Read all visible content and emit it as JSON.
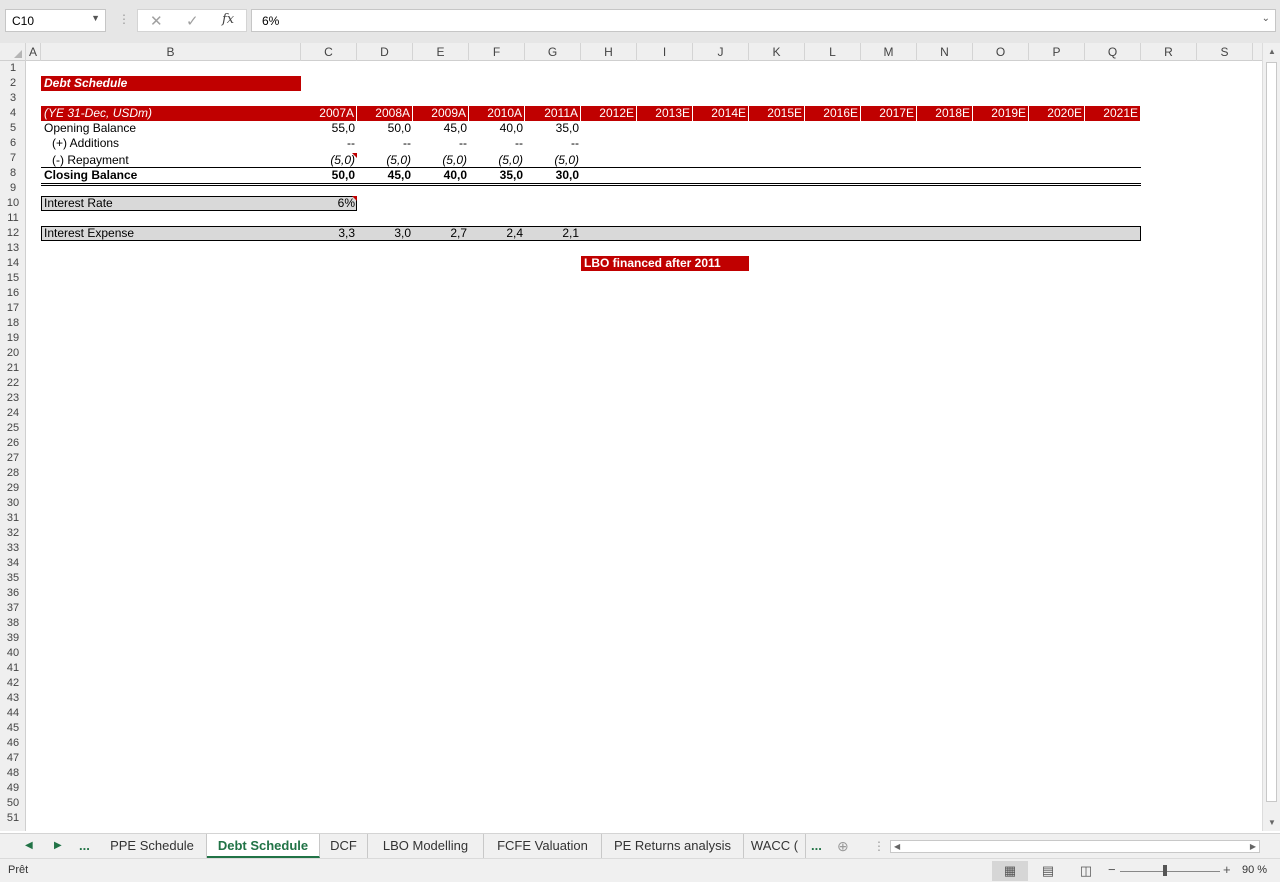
{
  "formula_bar": {
    "name_box": "C10",
    "formula": "6%",
    "cancel_icon": "✕",
    "enter_icon": "✓",
    "fx_icon": "fx"
  },
  "columns": [
    "A",
    "B",
    "C",
    "D",
    "E",
    "F",
    "G",
    "H",
    "I",
    "J",
    "K",
    "L",
    "M",
    "N",
    "O",
    "P",
    "Q",
    "R",
    "S"
  ],
  "rows": [
    "1",
    "2",
    "3",
    "4",
    "5",
    "6",
    "7",
    "8",
    "9",
    "10",
    "11",
    "12",
    "13",
    "14",
    "15",
    "16",
    "17",
    "18",
    "19",
    "20",
    "21",
    "22",
    "23",
    "24",
    "25",
    "26",
    "27",
    "28",
    "29",
    "30",
    "31",
    "32",
    "33",
    "34",
    "35",
    "36",
    "37",
    "38",
    "39",
    "40",
    "41",
    "42",
    "43",
    "44",
    "45",
    "46",
    "47",
    "48",
    "49",
    "50",
    "51"
  ],
  "sheet": {
    "title": "Debt Schedule",
    "header_label": "(YE 31-Dec, USDm)",
    "years": [
      "2007A",
      "2008A",
      "2009A",
      "2010A",
      "2011A",
      "2012E",
      "2013E",
      "2014E",
      "2015E",
      "2016E",
      "2017E",
      "2018E",
      "2019E",
      "2020E",
      "2021E"
    ],
    "opening_balance": {
      "label": "Opening Balance",
      "values": [
        "55,0",
        "50,0",
        "45,0",
        "40,0",
        "35,0"
      ]
    },
    "additions": {
      "label": "(+) Additions",
      "values": [
        "--",
        "--",
        "--",
        "--",
        "--"
      ]
    },
    "repayment": {
      "label": "(-) Repayment",
      "values": [
        "(5,0)",
        "(5,0)",
        "(5,0)",
        "(5,0)",
        "(5,0)"
      ]
    },
    "closing_balance": {
      "label": "Closing Balance",
      "values": [
        "50,0",
        "45,0",
        "40,0",
        "35,0",
        "30,0"
      ]
    },
    "interest_rate": {
      "label": "Interest Rate",
      "value": "6%"
    },
    "interest_expense": {
      "label": "Interest Expense",
      "values": [
        "3,3",
        "3,0",
        "2,7",
        "2,4",
        "2,1"
      ]
    },
    "note": "LBO financed after 2011"
  },
  "tabs": {
    "items": [
      {
        "label": "PPE Schedule",
        "active": false
      },
      {
        "label": "Debt Schedule",
        "active": true
      },
      {
        "label": "DCF",
        "active": false
      },
      {
        "label": "LBO Modelling",
        "active": false
      },
      {
        "label": "FCFE Valuation",
        "active": false
      },
      {
        "label": "PE Returns analysis",
        "active": false
      },
      {
        "label": "WACC (",
        "active": false
      }
    ],
    "more_left": "...",
    "more_right": "..."
  },
  "status": {
    "text": "Prêt",
    "zoom": "90 %",
    "zoom_level": 0.9
  },
  "colors": {
    "accent_red": "#c00000",
    "excel_green": "#217346",
    "band_grey": "#d9d9d9"
  }
}
